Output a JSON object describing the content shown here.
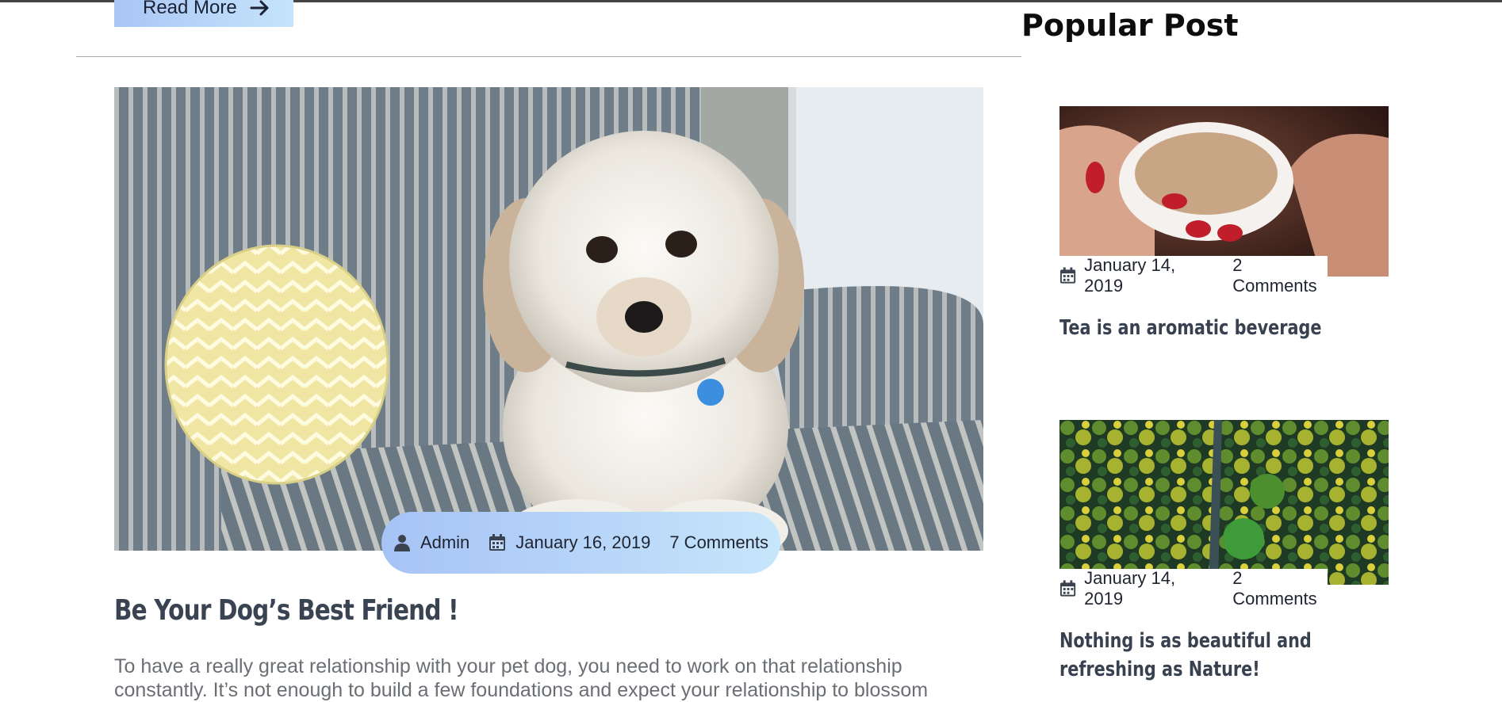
{
  "main": {
    "read_more_label": "Read More",
    "post": {
      "author": "Admin",
      "date": "January 16, 2019",
      "comments": "7 Comments",
      "title": "Be Your Dog’s Best Friend !",
      "excerpt": "To have a really great relationship with your pet dog, you need to work on that relationship constantly. It’s not enough to build a few foundations and expect your relationship to blossom"
    }
  },
  "sidebar": {
    "title": "Popular Post",
    "posts": [
      {
        "date": "January 14, 2019",
        "comments": "2 Comments",
        "title": "Tea is an aromatic beverage"
      },
      {
        "date": "January 14, 2019",
        "comments": "2 Comments",
        "title": "Nothing is as beautiful and refreshing as Nature!"
      }
    ]
  },
  "colors": {
    "pill_gradient_start": "#a6c3f6",
    "pill_gradient_end": "#c6e6fb",
    "heading": "#3a4352",
    "body_text": "#6b6f74"
  },
  "icons": {
    "read_more": "arrow-right-icon",
    "author": "user-icon",
    "date": "calendar-icon"
  }
}
